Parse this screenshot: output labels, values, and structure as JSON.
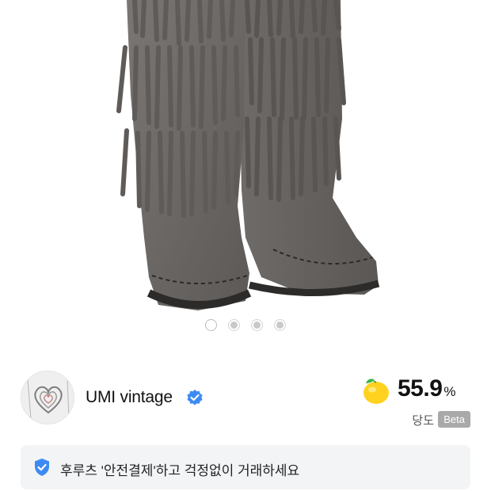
{
  "gallery": {
    "image_alt": "Gray suede fringe moccasin boots",
    "dot_count": 4,
    "active_index": 0
  },
  "seller": {
    "name": "UMI vintage",
    "avatar_icon": "heart-sketch-avatar",
    "verified_icon": "verified-check-icon"
  },
  "temperature": {
    "value": "55.9",
    "unit": "%",
    "label": "당도",
    "badge": "Beta",
    "icon": "lemon-icon"
  },
  "safe_payment": {
    "icon": "shield-check-icon",
    "text": "후루츠 '안전결제'하고 걱정없이 거래하세요"
  },
  "colors": {
    "accent_blue": "#3d8bf2",
    "lemon": "#ffd21f",
    "leaf": "#3bb54a",
    "boot": "#6d6a68"
  }
}
